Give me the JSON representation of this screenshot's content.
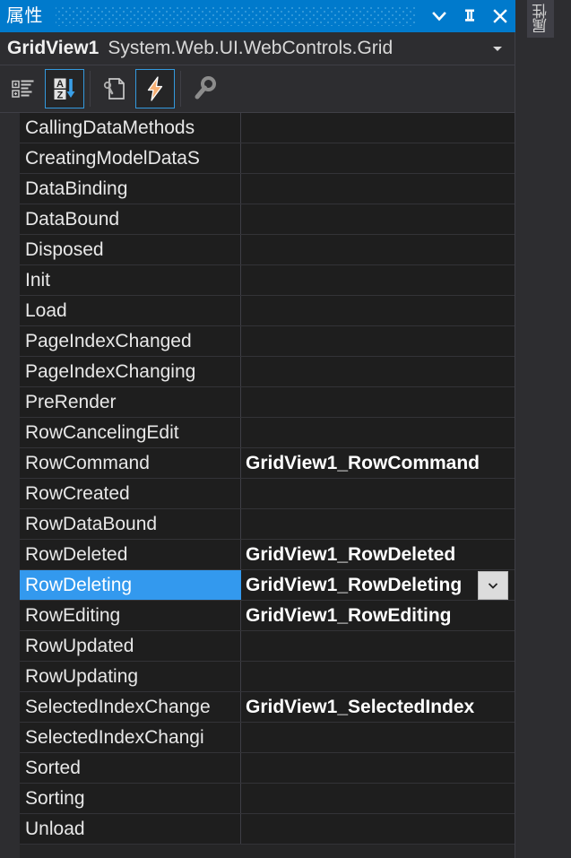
{
  "window": {
    "title": "属性",
    "title_icon": "grip-dots",
    "buttons": [
      {
        "name": "window-menu-button",
        "icon": "chevron-down-icon"
      },
      {
        "name": "auto-hide-pin-button",
        "icon": "pin-icon"
      },
      {
        "name": "close-button",
        "icon": "close-icon"
      }
    ]
  },
  "object_selector": {
    "object_name": "GridView1",
    "object_type": "System.Web.UI.WebControls.Grid",
    "dropdown_icon": "chevron-down-icon"
  },
  "toolbar": {
    "buttons": [
      {
        "name": "categorized-view-button",
        "icon": "categorized-icon",
        "active": false
      },
      {
        "name": "alphabetical-view-button",
        "icon": "sort-az-icon",
        "active": true
      },
      {
        "name": "properties-view-button",
        "icon": "property-page-icon",
        "active": false
      },
      {
        "name": "events-view-button",
        "icon": "lightning-icon",
        "active": true
      },
      {
        "name": "property-pages-button",
        "icon": "wrench-icon",
        "active": false
      }
    ]
  },
  "grid": {
    "selected_row": "RowDeleting",
    "value_dropdown_icon": "chevron-down-icon",
    "rows": [
      {
        "name": "CallingDataMethods",
        "value": ""
      },
      {
        "name": "CreatingModelDataS",
        "value": ""
      },
      {
        "name": "DataBinding",
        "value": ""
      },
      {
        "name": "DataBound",
        "value": ""
      },
      {
        "name": "Disposed",
        "value": ""
      },
      {
        "name": "Init",
        "value": ""
      },
      {
        "name": "Load",
        "value": ""
      },
      {
        "name": "PageIndexChanged",
        "value": ""
      },
      {
        "name": "PageIndexChanging",
        "value": ""
      },
      {
        "name": "PreRender",
        "value": ""
      },
      {
        "name": "RowCancelingEdit",
        "value": ""
      },
      {
        "name": "RowCommand",
        "value": "GridView1_RowCommand"
      },
      {
        "name": "RowCreated",
        "value": ""
      },
      {
        "name": "RowDataBound",
        "value": ""
      },
      {
        "name": "RowDeleted",
        "value": "GridView1_RowDeleted"
      },
      {
        "name": "RowDeleting",
        "value": "GridView1_RowDeleting"
      },
      {
        "name": "RowEditing",
        "value": "GridView1_RowEditing"
      },
      {
        "name": "RowUpdated",
        "value": ""
      },
      {
        "name": "RowUpdating",
        "value": ""
      },
      {
        "name": "SelectedIndexChange",
        "value": "GridView1_SelectedIndex"
      },
      {
        "name": "SelectedIndexChangi",
        "value": ""
      },
      {
        "name": "Sorted",
        "value": ""
      },
      {
        "name": "Sorting",
        "value": ""
      },
      {
        "name": "Unload",
        "value": ""
      }
    ]
  },
  "rail": {
    "tab_label": "属性"
  },
  "colors": {
    "titlebar": "#007acc",
    "selection": "#3399ee",
    "panel_bg": "#252526",
    "row_bg": "#1e1e1e",
    "accent_border": "#3399dd"
  }
}
